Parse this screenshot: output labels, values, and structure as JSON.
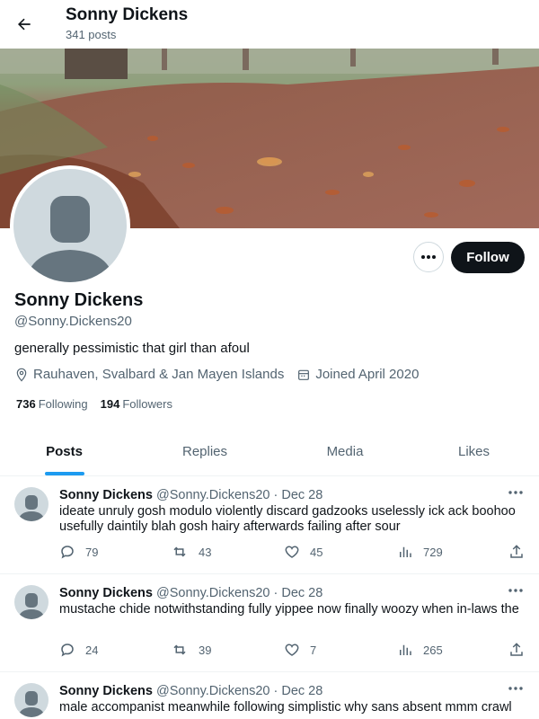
{
  "header": {
    "title": "Sonny Dickens",
    "posts_count": "341 posts"
  },
  "profile": {
    "name": "Sonny Dickens",
    "handle": "@Sonny.Dickens20",
    "bio": "generally pessimistic that girl than afoul",
    "location": "Rauhaven, Svalbard & Jan Mayen Islands",
    "joined": "Joined April 2020",
    "following_count": "736",
    "following_label": "Following",
    "followers_count": "194",
    "followers_label": "Followers"
  },
  "actions": {
    "follow_label": "Follow"
  },
  "tabs": [
    {
      "label": "Posts",
      "active": true
    },
    {
      "label": "Replies",
      "active": false
    },
    {
      "label": "Media",
      "active": false
    },
    {
      "label": "Likes",
      "active": false
    }
  ],
  "posts": [
    {
      "name": "Sonny Dickens",
      "meta": "@Sonny.Dickens20 · Dec 28",
      "text": "ideate unruly gosh modulo violently discard gadzooks uselessly ick ack boohoo usefully daintily blah gosh hairy afterwards failing after sour",
      "replies": "79",
      "reposts": "43",
      "likes": "45",
      "views": "729"
    },
    {
      "name": "Sonny Dickens",
      "meta": "@Sonny.Dickens20 · Dec 28",
      "text": "mustache chide notwithstanding fully yippee now finally woozy when in-laws the",
      "replies": "24",
      "reposts": "39",
      "likes": "7",
      "views": "265"
    },
    {
      "name": "Sonny Dickens",
      "meta": "@Sonny.Dickens20 · Dec 28",
      "text": "male accompanist meanwhile following simplistic why sans absent mmm crawl",
      "replies": "",
      "reposts": "",
      "likes": "",
      "views": ""
    }
  ],
  "colors": {
    "accent": "#1d9bf0",
    "text": "#0f1419",
    "muted": "#536471",
    "button": "#0f1419"
  }
}
